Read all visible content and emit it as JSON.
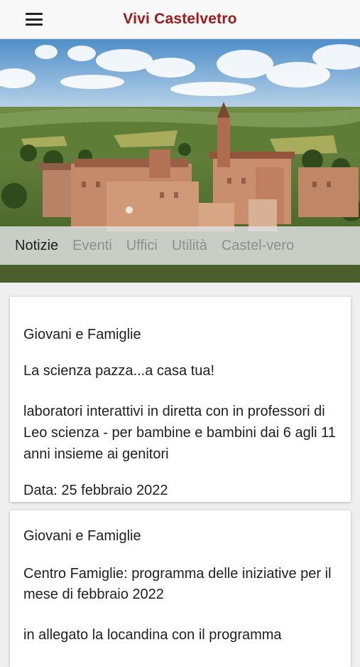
{
  "header": {
    "title": "Vivi Castelvetro",
    "menu_icon": "hamburger-menu-icon"
  },
  "tabs": [
    {
      "label": "Notizie",
      "active": true
    },
    {
      "label": "Eventi",
      "active": false
    },
    {
      "label": "Uffici",
      "active": false
    },
    {
      "label": "Utilità",
      "active": false
    },
    {
      "label": "Castel-vero",
      "active": false
    }
  ],
  "news": [
    {
      "category": "Giovani e Famiglie",
      "title": "La scienza pazza...a casa tua!",
      "description": "laboratori interattivi in diretta con in professori di Leo scienza - per bambine e bambini dai 6 agli 11 anni insieme ai genitori",
      "date": "Data: 25 febbraio 2022"
    },
    {
      "category": "Giovani e Famiglie",
      "title": "Centro Famiglie: programma delle iniziative per il mese di febbraio 2022",
      "description": "in allegato la locandina con il programma"
    }
  ]
}
